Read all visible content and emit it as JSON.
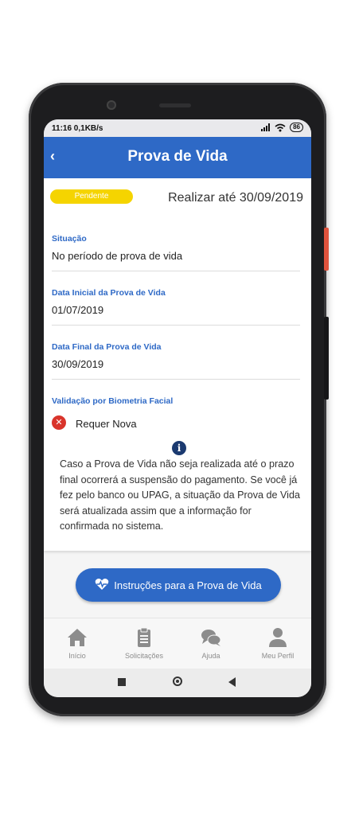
{
  "status_bar": {
    "time": "11:16 0,1KB/s",
    "battery": "86"
  },
  "app_bar": {
    "back_icon": "chevron-left-icon",
    "back_glyph": "‹",
    "title": "Prova de Vida"
  },
  "status": {
    "badge": "Pendente",
    "deadline": "Realizar até 30/09/2019",
    "badge_color": "#f5d400"
  },
  "fields": [
    {
      "label": "Situação",
      "value": "No período de prova de vida"
    },
    {
      "label": "Data Inicial da Prova de Vida",
      "value": "01/07/2019"
    },
    {
      "label": "Data Final da Prova de Vida",
      "value": "30/09/2019"
    }
  ],
  "biometria": {
    "label": "Validação por Biometria Facial",
    "status_icon": "x-circle-icon",
    "status_glyph": "✕",
    "status": "Requer Nova"
  },
  "info": {
    "icon": "info-icon",
    "glyph": "i",
    "text": "Caso a Prova de Vida não seja realizada até o prazo final ocorrerá a suspensão do pagamento. Se você já fez pelo banco ou UPAG, a situação da Prova de Vida será atualizada assim que a informação for confirmada no sistema."
  },
  "cta": {
    "icon": "heartbeat-icon",
    "label": "Instruções para a Prova de Vida"
  },
  "tabs": [
    {
      "icon": "home-icon",
      "label": "Início"
    },
    {
      "icon": "clipboard-icon",
      "label": "Solicitações"
    },
    {
      "icon": "chat-icon",
      "label": "Ajuda"
    },
    {
      "icon": "user-icon",
      "label": "Meu Perfil"
    }
  ],
  "colors": {
    "primary": "#2e69c6",
    "badge": "#f5d400",
    "error": "#d9342b",
    "info": "#1b3a70"
  }
}
